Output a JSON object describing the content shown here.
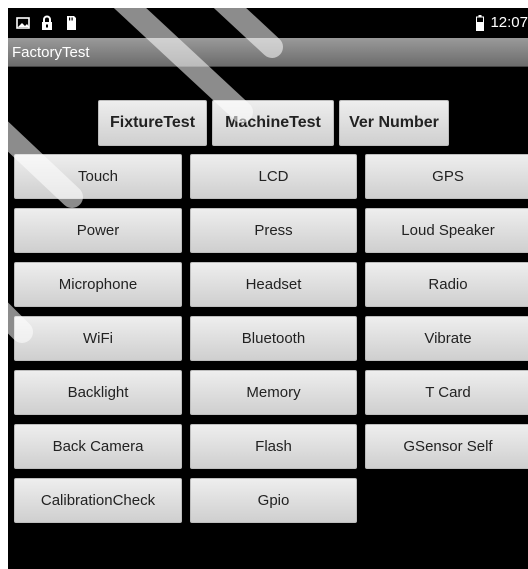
{
  "status_bar": {
    "left_icons": [
      "image-icon",
      "lock-icon",
      "sd-card-icon"
    ],
    "battery_icon": "battery-icon",
    "time": "12:07"
  },
  "app": {
    "title": "FactoryTest"
  },
  "top_buttons": [
    {
      "label": "FixtureTest"
    },
    {
      "label": "MachineTest"
    },
    {
      "label": "Ver Number"
    }
  ],
  "test_buttons": [
    {
      "label": "Touch"
    },
    {
      "label": "LCD"
    },
    {
      "label": "GPS"
    },
    {
      "label": "Power"
    },
    {
      "label": "Press"
    },
    {
      "label": "Loud Speaker"
    },
    {
      "label": "Microphone"
    },
    {
      "label": "Headset"
    },
    {
      "label": "Radio"
    },
    {
      "label": "WiFi"
    },
    {
      "label": "Bluetooth"
    },
    {
      "label": "Vibrate"
    },
    {
      "label": "Backlight"
    },
    {
      "label": "Memory"
    },
    {
      "label": "T Card"
    },
    {
      "label": "Back Camera"
    },
    {
      "label": "Flash"
    },
    {
      "label": "GSensor Self"
    },
    {
      "label": "CalibrationCheck"
    },
    {
      "label": "Gpio"
    }
  ]
}
